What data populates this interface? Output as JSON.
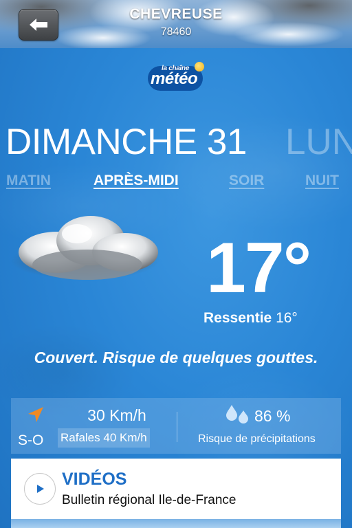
{
  "header": {
    "city": "CHEVREUSE",
    "postal_code": "78460"
  },
  "logo": {
    "small_text": "la chaîne",
    "brand_text": "météo"
  },
  "forecast": {
    "day_label": "DIMANCHE 31",
    "next_day_label": "LUN",
    "periods": [
      "MATIN",
      "APRÈS-MIDI",
      "SOIR",
      "NUIT"
    ],
    "active_period": "APRÈS-MIDI",
    "temperature": "17°",
    "feels_like_label": "Ressentie",
    "feels_like_value": "16°",
    "description": "Couvert. Risque de quelques gouttes."
  },
  "wind": {
    "direction": "S-O",
    "speed": "30 Km/h",
    "gusts": "Rafales 40 Km/h",
    "arrow_color": "#f08a24"
  },
  "precipitation": {
    "value": "86 %",
    "label": "Risque de précipitations"
  },
  "videos": {
    "title": "VIDÉOS",
    "subtitle": "Bulletin régional Ile-de-France"
  },
  "colors": {
    "background": "#2a86d6",
    "accent": "#1f6fc6"
  },
  "icons": [
    "back-arrow-icon",
    "cloud-icon",
    "wind-arrow-icon",
    "raindrops-icon",
    "play-icon"
  ]
}
